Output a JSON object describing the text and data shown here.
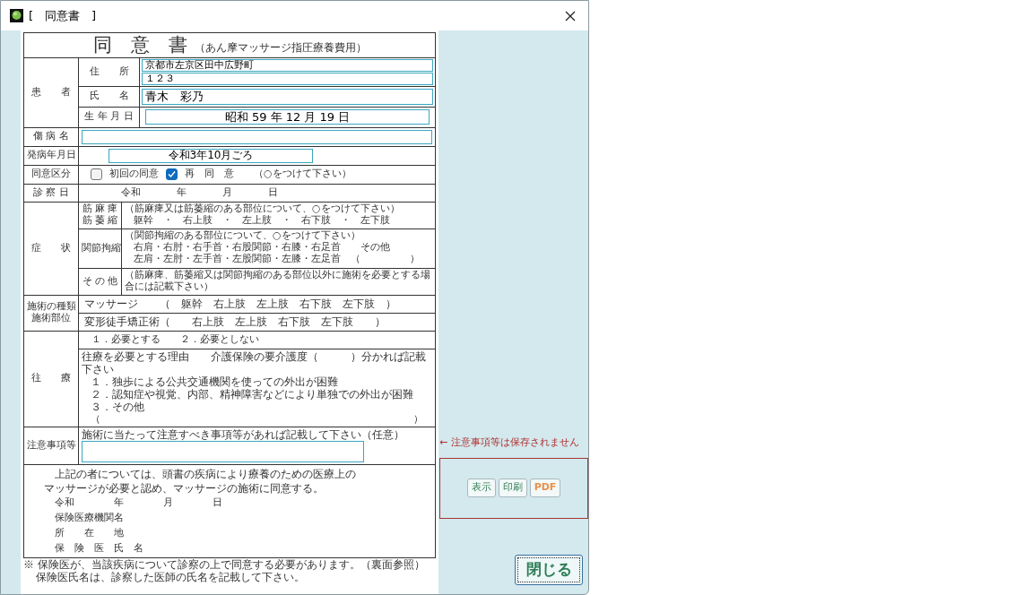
{
  "window": {
    "title": "[　同意書　]"
  },
  "form": {
    "title": "同　意　書",
    "subtitle": "（あん摩マッサージ指圧療養費用）",
    "patient": {
      "label": "患　　者",
      "address_label": "住　　所",
      "address_line1": "京都市左京区田中広野町",
      "address_line2": "１２３",
      "name_label": "氏　　名",
      "name": "青木　彩乃",
      "birth_label": "生 年 月 日",
      "birth_date": "昭和 59 年 12 月 19 日"
    },
    "injury": {
      "label": "傷 病 名"
    },
    "onset": {
      "label": "発病年月日",
      "value": "令和3年10月ごろ"
    },
    "consent": {
      "label": "同意区分",
      "options": [
        {
          "label": "初回の同意",
          "checked": false
        },
        {
          "label": "再　同　意",
          "checked": true
        }
      ],
      "note": "（○をつけて下さい）"
    },
    "exam_date": {
      "label": "診 察 日",
      "parts": [
        "令和",
        "年",
        "月",
        "日"
      ]
    },
    "symptoms": {
      "label": "症　　状",
      "rows": [
        {
          "label_lines": [
            "筋 麻 痺",
            "筋 萎 縮"
          ],
          "hint": "（筋麻痺又は筋萎縮のある部位について、○をつけて下さい）",
          "lines": [
            "躯幹　・　右上肢　・　左上肢　・　右下肢　・　左下肢"
          ]
        },
        {
          "label_lines": [
            "関節拘縮"
          ],
          "hint": "（関節拘縮のある部位について、○をつけて下さい）",
          "lines": [
            "右肩・右肘・右手首・右股関節・右膝・右足首　　その他",
            "左肩・左肘・左手首・左股関節・左膝・左足首　（　　　　　）"
          ]
        },
        {
          "label_lines": [
            "そ の 他"
          ],
          "hint": "（筋麻痺、筋萎縮又は関節拘縮のある部位以外に施術を必要とする場合には記載下さい）",
          "lines": []
        }
      ]
    },
    "treatment": {
      "label_lines": [
        "施術の種類",
        "施術部位"
      ],
      "rows": [
        "マッサージ　　（　躯幹　右上肢　左上肢　右下肢　左下肢　）",
        "変形徒手矯正術（　　右上肢　左上肢　右下肢　左下肢　　）"
      ]
    },
    "visit": {
      "label": "往　　療",
      "choice": "１．必要とする　　２．必要としない",
      "hint": "往療を必要とする理由　　介護保険の要介護度（　　　）分かれば記載下さい",
      "lines": [
        "１．独歩による公共交通機関を使っての外出が困難",
        "２．認知症や視覚、内部、精神障害などにより単独での外出が困難",
        "３．その他"
      ],
      "brackets": [
        "（",
        "）"
      ]
    },
    "caution": {
      "label": "注意事項等",
      "hint": "施術に当たって注意すべき事項等があれば記載して下さい（任意）"
    },
    "statement": {
      "lines": [
        "上記の者については、頭書の疾病により療養のための医療上の",
        "マッサージが必要と認め、マッサージの施術に同意する。"
      ],
      "date_parts": [
        "令和",
        "年",
        "月",
        "日"
      ],
      "sign_labels": [
        "保険医療機関名",
        "所　　在　　地",
        "保　険　医　氏　名"
      ]
    },
    "footnotes": [
      "※ 保険医が、当該疾病について診察の上で同意する必要があります。（裏面参照）",
      "保険医氏名は、診察した医師の氏名を記載して下さい。"
    ]
  },
  "side": {
    "warning": "← 注意事項等は保存されません",
    "buttons": [
      {
        "label": "表示",
        "kind": "normal"
      },
      {
        "label": "印刷",
        "kind": "normal"
      },
      {
        "label": "PDF",
        "kind": "pdf"
      }
    ],
    "close": "閉じる"
  }
}
